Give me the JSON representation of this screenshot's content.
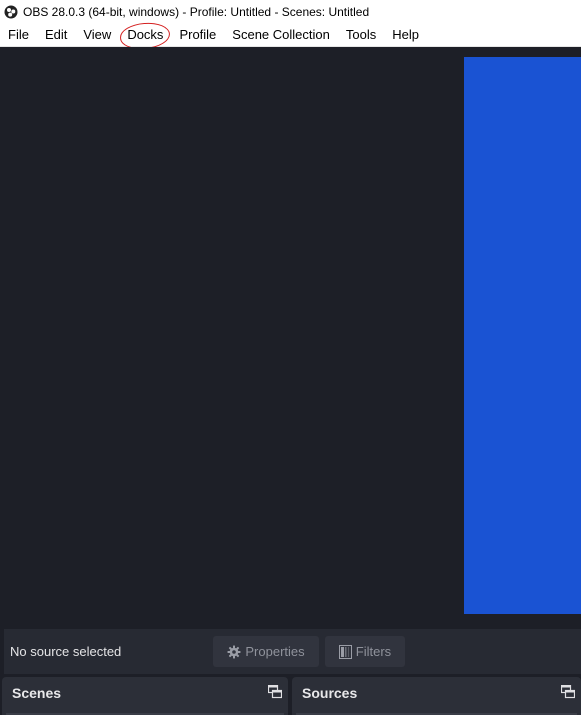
{
  "window": {
    "title": "OBS 28.0.3 (64-bit, windows) - Profile: Untitled - Scenes: Untitled",
    "icon": "obs-logo-icon"
  },
  "menubar": {
    "items": [
      "File",
      "Edit",
      "View",
      "Docks",
      "Profile",
      "Scene Collection",
      "Tools",
      "Help"
    ],
    "highlighted": "Docks"
  },
  "preview": {
    "background": "#1d1f27",
    "canvas_color": "#1a53d3"
  },
  "context_bar": {
    "status": "No source selected",
    "properties_label": "Properties",
    "filters_label": "Filters",
    "properties_icon": "gear-icon",
    "filters_icon": "filters-icon"
  },
  "docks": {
    "scenes_title": "Scenes",
    "sources_title": "Sources",
    "float_icon": "undock-icon"
  }
}
